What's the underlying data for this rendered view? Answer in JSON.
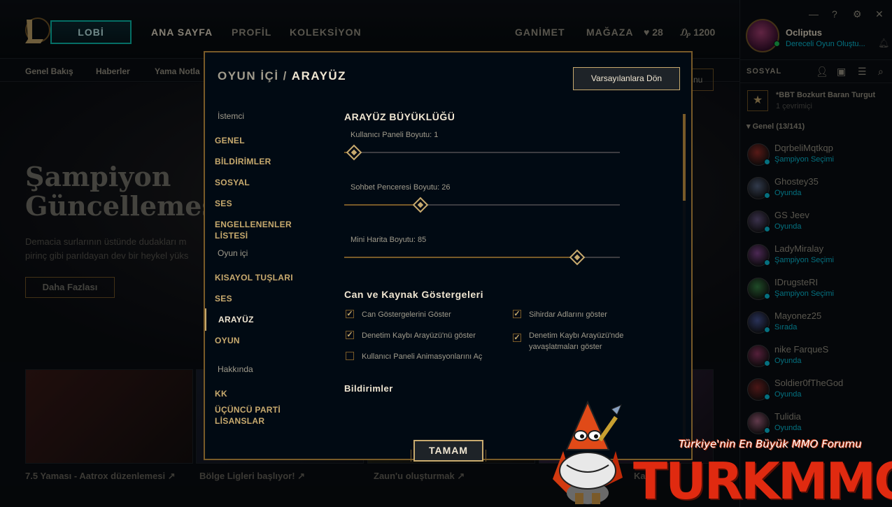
{
  "client": {
    "play_button": "LOBİ",
    "nav": [
      "ANA SAYFA",
      "PROFİL",
      "KOLEKSİYON"
    ],
    "nav_right": [
      "GANİMET",
      "MAĞAZA"
    ],
    "currency": {
      "rp": "28",
      "be": "1200"
    },
    "subnav": [
      "Genel Bakış",
      "Haberler",
      "Yama Notla"
    ],
    "hero": {
      "title_line1": "Şampiyon",
      "title_line2": "Güncellemesi",
      "desc": "Demacia surlarının üstünde dudakları m pirinç gibi parıldayan dev bir heykel yüks",
      "button": "Daha Fazlası"
    },
    "tiles": [
      "7.5 Yaması - Aatrox düzenlemesi ↗",
      "Bölge Ligleri başlıyor! ↗",
      "Zaun'u oluşturmak ↗",
      "Kar"
    ],
    "under_reset": "nu"
  },
  "window_controls": [
    "—",
    "?",
    "⚙",
    "✕"
  ],
  "profile": {
    "name": "Ocliptus",
    "status": "Dereceli Oyun Oluştu..."
  },
  "social": {
    "header": "SOSYAL",
    "club": {
      "name": "*BBT Bozkurt Baran Turgut",
      "sub": "1 çevrimiçi"
    },
    "group": "Genel (13/141)",
    "friends": [
      {
        "name": "DqrbeliMqtkqp",
        "status": "Şampiyon Seçimi",
        "color": "#a0302a"
      },
      {
        "name": "Ghostey35",
        "status": "Oyunda",
        "color": "#5a6a8a"
      },
      {
        "name": "GS Jeev",
        "status": "Oyunda",
        "color": "#6a5a8a"
      },
      {
        "name": "LadyMiralay",
        "status": "Şampiyon Seçimi",
        "color": "#8a4a9a"
      },
      {
        "name": "IDrugsteRI",
        "status": "Şampiyon Seçimi",
        "color": "#3a8a4a"
      },
      {
        "name": "Mayonez25",
        "status": "Sırada",
        "color": "#4a5aa0"
      },
      {
        "name": "nike FarqueS",
        "status": "Oyunda",
        "color": "#9a3a6a"
      },
      {
        "name": "Soldier0fTheGod",
        "status": "Oyunda",
        "color": "#8a2a2a"
      },
      {
        "name": "Tulidia",
        "status": "Oyunda",
        "color": "#b06a8a"
      }
    ]
  },
  "modal": {
    "breadcrumb_parent": "OYUN İÇİ",
    "breadcrumb_sep": "/",
    "breadcrumb_current": "ARAYÜZ",
    "reset_button": "Varsayılanlara Dön",
    "ok_button": "TAMAM",
    "sidebar": {
      "group1": "İstemci",
      "group1_items": [
        "GENEL",
        "BİLDİRİMLER",
        "SOSYAL",
        "SES",
        "ENGELLENENLER LİSTESİ"
      ],
      "group2": "Oyun içi",
      "group2_items": [
        "KISAYOL TUŞLARI",
        "SES",
        "ARAYÜZ",
        "OYUN"
      ],
      "group3": "Hakkında",
      "group3_items": [
        "KK",
        "ÜÇÜNCÜ PARTİ LİSANSLAR"
      ]
    },
    "interface_size": {
      "title": "ARAYÜZ BÜYÜKLÜĞÜ",
      "sliders": [
        {
          "label": "Kullanıcı Paneli Boyutu: 1",
          "value": 1
        },
        {
          "label": "Sohbet Penceresi Boyutu: 26",
          "value": 26
        },
        {
          "label": "Mini Harita Boyutu: 85",
          "value": 85
        }
      ]
    },
    "health_section": {
      "title": "Can ve Kaynak Göstergeleri",
      "checkboxes": [
        {
          "label": "Can Göstergelerini Göster",
          "checked": true
        },
        {
          "label": "Sihirdar Adlarını göster",
          "checked": true
        },
        {
          "label": "Denetim Kaybı Arayüzü'nü göster",
          "checked": true
        },
        {
          "label": "Denetim Kaybı Arayüzü'nde yavaşlatmaları göster",
          "checked": true
        },
        {
          "label": "Kullanıcı Paneli Animasyonlarını Aç",
          "checked": false
        }
      ]
    },
    "next_section": "Bildirimler"
  },
  "watermark": {
    "tagline": "Türkiye'nin En Büyük MMO Forumu",
    "brand": "TURKMMO"
  },
  "colors": {
    "gold": "#c8aa6e",
    "gold_dark": "#785a28",
    "teal": "#0acbe6",
    "bg": "#010a13",
    "text": "#a09b8c"
  }
}
